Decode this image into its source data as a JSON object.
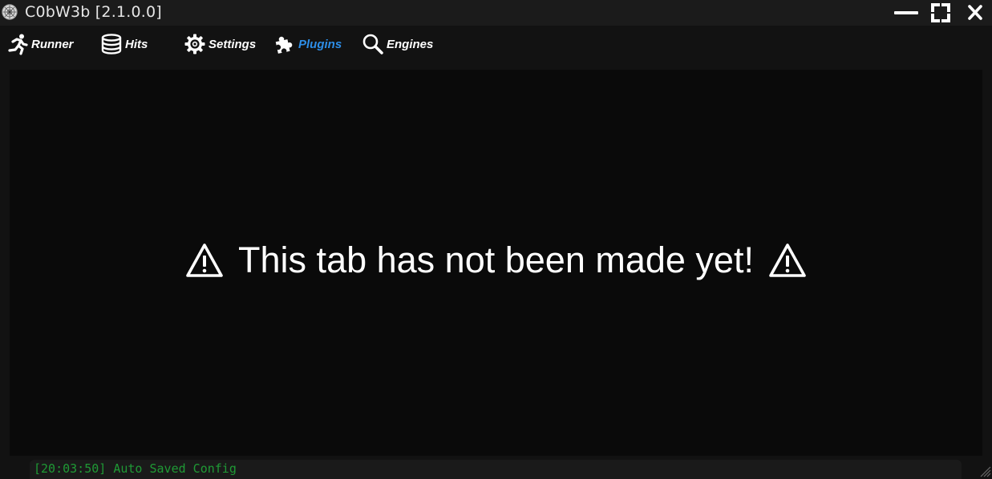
{
  "window": {
    "title": "C0bW3b [2.1.0.0]",
    "icon": "spider-web-icon",
    "controls": [
      "minimize-icon",
      "maximize-icon",
      "close-icon"
    ]
  },
  "tabs": [
    {
      "label": "Runner",
      "icon": "running-man-icon",
      "active": false
    },
    {
      "label": "Hits",
      "icon": "database-icon",
      "active": false
    },
    {
      "label": "Settings",
      "icon": "gear-icon",
      "active": false
    },
    {
      "label": "Plugins",
      "icon": "puzzle-piece-icon",
      "active": true
    },
    {
      "label": "Engines",
      "icon": "magnifier-icon",
      "active": false
    }
  ],
  "main": {
    "message": "This tab has not been made yet!",
    "icon": "warning-triangle-icon"
  },
  "status": {
    "log": "[20:03:50] Auto Saved Config"
  },
  "colors": {
    "background": "#121212",
    "panel": "#0a0a0a",
    "accent": "#2d8ee8",
    "log": "#1f9a35",
    "text": "#ffffff"
  }
}
